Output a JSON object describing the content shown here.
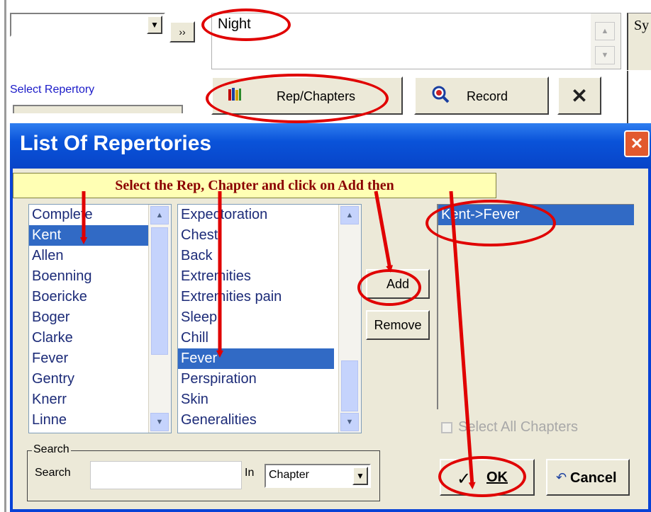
{
  "background": {
    "dropdown_value": "",
    "more_button": "››",
    "symptom_text": "Night",
    "select_repertory_label": "Select Repertory",
    "rep_chapters_button": "Rep/Chapters",
    "record_button": "Record",
    "delete_icon": "✕",
    "right_panel_text": "Sy"
  },
  "dialog": {
    "title": "List Of Repertories",
    "close_icon": "✕",
    "instruction": "Select the Rep, Chapter and click on Add then",
    "repertories": [
      "Complete",
      "Kent",
      "Allen",
      "Boenning",
      "Boericke",
      "Boger",
      "Clarke",
      "Fever",
      "Gentry",
      "Knerr",
      "Linne"
    ],
    "selected_repertory": 1,
    "chapters": [
      "Expectoration",
      "Chest",
      "Back",
      "Extremities",
      "Extremities pain",
      "Sleep",
      "Chill",
      "Fever",
      "Perspiration",
      "Skin",
      "Generalities"
    ],
    "selected_chapter": 7,
    "add_button": "Add",
    "remove_button": "Remove",
    "selected_items": [
      "Kent->Fever"
    ],
    "select_all_label": "Select All Chapters",
    "search_group_label": "Search",
    "search_label": "Search",
    "search_value": "",
    "in_label": "In",
    "in_select_value": "Chapter",
    "ok_button": "OK",
    "cancel_button": "Cancel"
  },
  "colors": {
    "annotation": "#e00000",
    "title_bar": "#0a53d9",
    "selection": "#316ac5",
    "instruction_text": "#8b0000",
    "instruction_bg": "#ffffb4"
  }
}
